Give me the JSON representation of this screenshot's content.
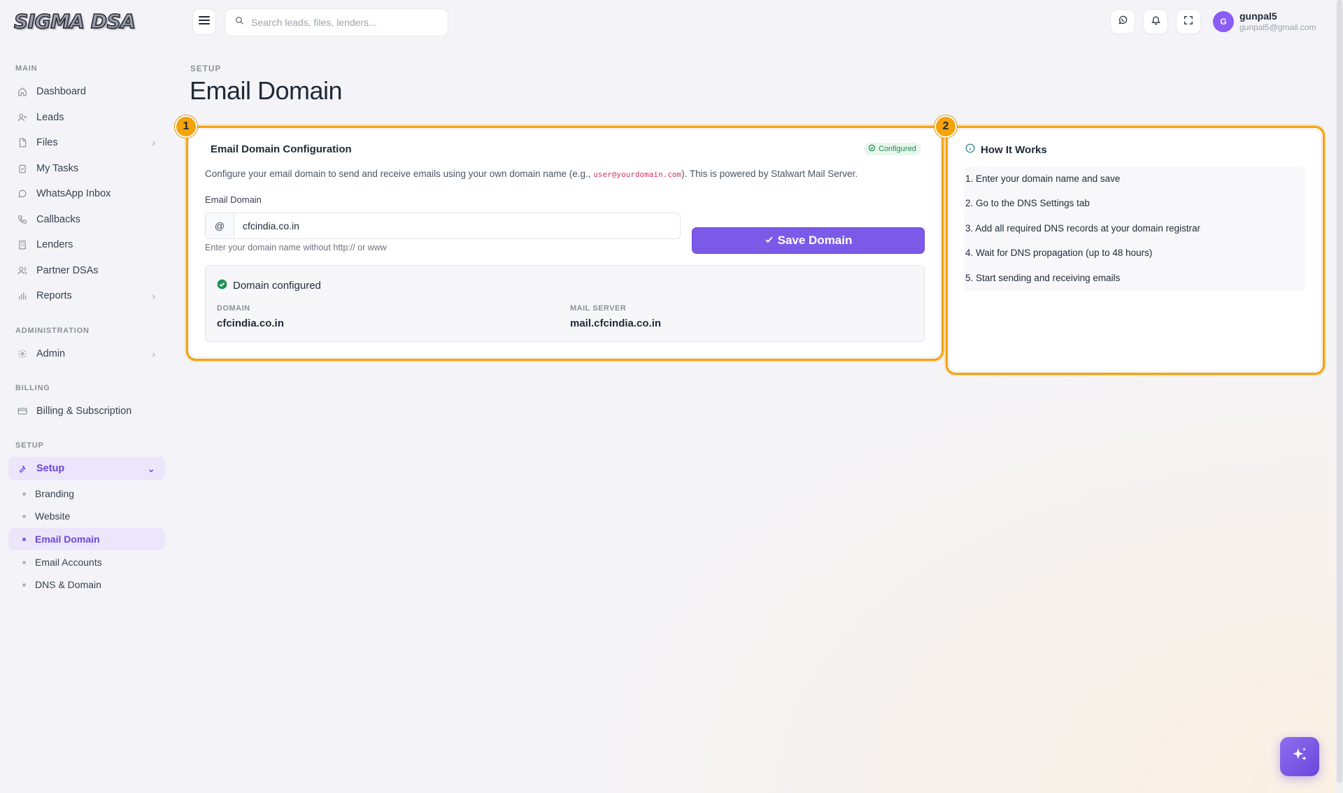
{
  "brand": {
    "logo_text": "SIGMA DSA"
  },
  "sidebar": {
    "sections": {
      "main": "MAIN",
      "administration": "ADMINISTRATION",
      "billing": "BILLING",
      "setup": "SETUP"
    },
    "items": [
      {
        "label": "Dashboard",
        "icon": "home-icon"
      },
      {
        "label": "Leads",
        "icon": "user-plus-icon"
      },
      {
        "label": "Files",
        "icon": "file-icon"
      },
      {
        "label": "My Tasks",
        "icon": "clipboard-check-icon"
      },
      {
        "label": "WhatsApp Inbox",
        "icon": "whatsapp-icon"
      },
      {
        "label": "Callbacks",
        "icon": "phone-icon"
      },
      {
        "label": "Lenders",
        "icon": "building-icon"
      },
      {
        "label": "Partner DSAs",
        "icon": "users-icon"
      },
      {
        "label": "Reports",
        "icon": "bar-chart-icon"
      },
      {
        "label": "Admin",
        "icon": "gear-icon"
      },
      {
        "label": "Billing & Subscription",
        "icon": "credit-card-icon"
      },
      {
        "label": "Setup",
        "icon": "wrench-icon"
      }
    ],
    "setup_subitems": [
      {
        "label": "Branding"
      },
      {
        "label": "Website"
      },
      {
        "label": "Email Domain"
      },
      {
        "label": "Email Accounts"
      },
      {
        "label": "DNS & Domain"
      }
    ]
  },
  "topbar": {
    "search_placeholder": "Search leads, files, lenders...",
    "user": {
      "initial": "G",
      "name": "gunpal5",
      "email": "gunpal5@gmail.com"
    }
  },
  "page": {
    "breadcrumb": "SETUP",
    "title": "Email Domain"
  },
  "config_card": {
    "badge_number": "1",
    "title": "Email Domain Configuration",
    "status_badge": "Configured",
    "description_before": "Configure your email domain to send and receive emails using your own domain name (e.g., ",
    "description_code": "user@yourdomain.com",
    "description_after": "). This is powered by Stalwart Mail Server.",
    "field_label": "Email Domain",
    "input_prefix": "@",
    "input_value": "cfcindia.co.in",
    "help_text": "Enter your domain name without http:// or www",
    "save_button": "Save Domain",
    "status": {
      "heading": "Domain configured",
      "domain_label": "DOMAIN",
      "domain_value": "cfcindia.co.in",
      "mail_server_label": "MAIL SERVER",
      "mail_server_value": "mail.cfcindia.co.in"
    }
  },
  "how_card": {
    "badge_number": "2",
    "title": "How It Works",
    "steps": [
      "1. Enter your domain name and save",
      "2. Go to the DNS Settings tab",
      "3. Add all required DNS records at your domain registrar",
      "4. Wait for DNS propagation (up to 48 hours)",
      "5. Start sending and receiving emails"
    ]
  },
  "colors": {
    "accent": "#7c5ae8",
    "highlight": "#f5a30b",
    "success": "#218a4d"
  }
}
